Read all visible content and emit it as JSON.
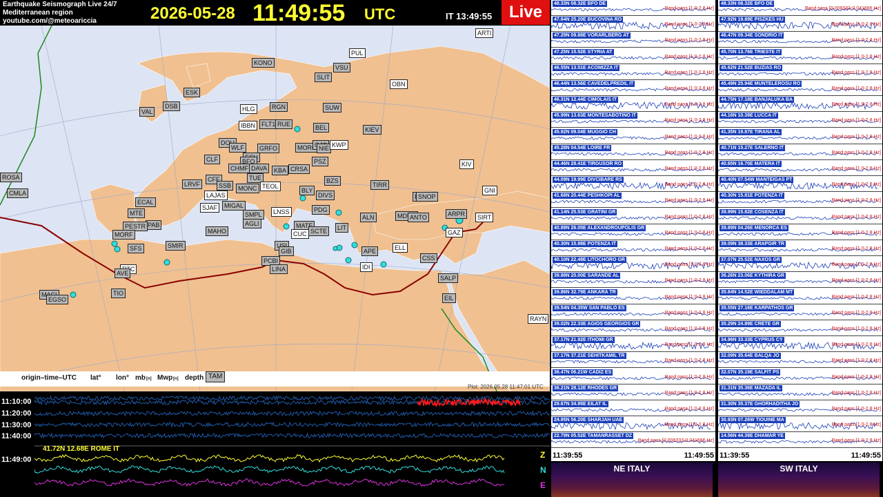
{
  "header": {
    "line1": "Earthquake Seismograph Live 24/7",
    "line2": "Mediterranean region",
    "line3": "youtube.com/@meteoariccia",
    "date": "2026-05-28",
    "time": "11:49:55",
    "tz": "UTC",
    "local": "IT 13:49:55",
    "live": "Live"
  },
  "legend": {
    "origin": "origin–time–UTC",
    "lat": "lat°",
    "lon": "lon°",
    "mb": "mb",
    "mb_sub": "[n]",
    "mwp": "Mwp",
    "mwp_sub": "[n]",
    "depth": "depth",
    "station": "TAM"
  },
  "plot_note": "Plot: 2026.05.28 11:47:01 UTC",
  "map_stations": [
    {
      "t": "ARTI",
      "w": 1
    },
    {
      "t": "PUL",
      "w": 1
    },
    {
      "t": "KONO",
      "w": 0
    },
    {
      "t": "VSU",
      "w": 0
    },
    {
      "t": "SLIT",
      "w": 0
    },
    {
      "t": "OBN",
      "w": 1
    },
    {
      "t": "ESK",
      "w": 0
    },
    {
      "t": "DSB",
      "w": 0
    },
    {
      "t": "VAL",
      "w": 0
    },
    {
      "t": "HLG",
      "w": 1
    },
    {
      "t": "RGN",
      "w": 0
    },
    {
      "t": "SUW",
      "w": 0
    },
    {
      "t": "IBBN",
      "w": 1
    },
    {
      "t": "FLT1",
      "w": 0
    },
    {
      "t": "RUE",
      "w": 0
    },
    {
      "t": "BEL",
      "w": 0
    },
    {
      "t": "KIEV",
      "w": 0
    },
    {
      "t": "DOU",
      "w": 0
    },
    {
      "t": "WLF",
      "w": 0
    },
    {
      "t": "GRFO",
      "w": 0
    },
    {
      "t": "MORC",
      "w": 0
    },
    {
      "t": "OJC",
      "w": 0
    },
    {
      "t": "NIE",
      "w": 0
    },
    {
      "t": "KWP",
      "w": 1
    },
    {
      "t": "CLF",
      "w": 0
    },
    {
      "t": "ECH",
      "w": 0
    },
    {
      "t": "BFO",
      "w": 0
    },
    {
      "t": "CHMF",
      "w": 0
    },
    {
      "t": "DAVA",
      "w": 0
    },
    {
      "t": "KBA",
      "w": 0
    },
    {
      "t": "CRSA",
      "w": 0
    },
    {
      "t": "PSZ",
      "w": 0
    },
    {
      "t": "KIV",
      "w": 1
    },
    {
      "t": "CFF",
      "w": 0
    },
    {
      "t": "SSB",
      "w": 0
    },
    {
      "t": "TUE",
      "w": 0
    },
    {
      "t": "LRVF",
      "w": 0
    },
    {
      "t": "MONC",
      "w": 0
    },
    {
      "t": "TEOL",
      "w": 1
    },
    {
      "t": "BZS",
      "w": 0
    },
    {
      "t": "TIRR",
      "w": 0
    },
    {
      "t": "GNI",
      "w": 1
    },
    {
      "t": "ROSA",
      "w": 0
    },
    {
      "t": "CMLA",
      "w": 0
    },
    {
      "t": "LAJAS",
      "w": 1
    },
    {
      "t": "BLY",
      "w": 0
    },
    {
      "t": "DIVS",
      "w": 0
    },
    {
      "t": "SJAF",
      "w": 1
    },
    {
      "t": "MIGAL",
      "w": 0
    },
    {
      "t": "ECAL",
      "w": 0
    },
    {
      "t": "BZN",
      "w": 0
    },
    {
      "t": "SNOP",
      "w": 0
    },
    {
      "t": "PDG",
      "w": 0
    },
    {
      "t": "SMPL",
      "w": 0
    },
    {
      "t": "LNSS",
      "w": 1
    },
    {
      "t": "MAHO",
      "w": 0
    },
    {
      "t": "AGLI",
      "w": 0
    },
    {
      "t": "MATE",
      "w": 0
    },
    {
      "t": "CUC",
      "w": 1
    },
    {
      "t": "SCTE",
      "w": 0
    },
    {
      "t": "LIT",
      "w": 0
    },
    {
      "t": "ALN",
      "w": 0
    },
    {
      "t": "MDUB",
      "w": 0
    },
    {
      "t": "ANTO",
      "w": 0
    },
    {
      "t": "ARPR",
      "w": 0
    },
    {
      "t": "SIRT",
      "w": 1
    },
    {
      "t": "GAZ",
      "w": 1
    },
    {
      "t": "PAB",
      "w": 0
    },
    {
      "t": "PESTR",
      "w": 0
    },
    {
      "t": "MTE",
      "w": 0
    },
    {
      "t": "SFS",
      "w": 0
    },
    {
      "t": "MORF",
      "w": 0
    },
    {
      "t": "SMIR",
      "w": 0
    },
    {
      "t": "USI",
      "w": 0
    },
    {
      "t": "GIB",
      "w": 0
    },
    {
      "t": "APE",
      "w": 0
    },
    {
      "t": "ELL",
      "w": 1
    },
    {
      "t": "IDI",
      "w": 1
    },
    {
      "t": "CSS",
      "w": 0
    },
    {
      "t": "RTC",
      "w": 1
    },
    {
      "t": "AVE",
      "w": 0
    },
    {
      "t": "PCBI",
      "w": 0
    },
    {
      "t": "LINA",
      "w": 0
    },
    {
      "t": "SALP",
      "w": 0
    },
    {
      "t": "MACI",
      "w": 0
    },
    {
      "t": "EGSO",
      "w": 0
    },
    {
      "t": "TIO",
      "w": 0
    },
    {
      "t": "EIL",
      "w": 0
    },
    {
      "t": "RAYN",
      "w": 1
    }
  ],
  "helicorder": {
    "times": [
      "11:10:00",
      "11:20:00",
      "11:30:00",
      "11:40:00",
      "11:49:00"
    ],
    "rome_label": "41.72N 12.68E ROME IT",
    "components": [
      "Z",
      "N",
      "E"
    ],
    "component_colors": [
      "#ffff33",
      "#33dddd",
      "#dd33dd"
    ]
  },
  "col1": {
    "rows": [
      {
        "n": "48.33N 08.32E BFO DE",
        "b": "Band pass [1.0-2.8 Hz]"
      },
      {
        "n": "47.64N 25.20E BUCOVINA RO",
        "b": "Band pass [1.0-2.8 Hz]"
      },
      {
        "n": "47.29N 09.88E VORARLBERG AT",
        "b": "Band pass [1.0-2.8 Hz]"
      },
      {
        "n": "47.25N 15.52E STYRIA AT",
        "b": "Band pass [1.0-2.8 Hz]"
      },
      {
        "n": "46.55N 13.51E ACOMIZZA IT",
        "b": "Band pass [1.0-2.8 Hz]"
      },
      {
        "n": "46.44N 13.56E CAVEDELPREDIL IT",
        "b": "Band pass [1.0-2.8 Hz]"
      },
      {
        "n": "46.31N 12.44E CIMOLAIS IT",
        "b": "Band pass [1.0-2.8 Hz]"
      },
      {
        "n": "45.99N 13.63E MONTESABOTINO IT",
        "b": "Band pass [1.0-2.8 Hz]"
      },
      {
        "n": "45.92N 09.04E MUGGIO CH",
        "b": "Band pass [1.0-2.8 Hz]"
      },
      {
        "n": "45.28N 04.54E LOIRE FR",
        "b": "Band pass [1.0-2.8 Hz]"
      },
      {
        "n": "44.46N 28.41E TIRGUSOR RO",
        "b": "Band pass [1.0-2.8 Hz]"
      },
      {
        "n": "44.09N 19.99E DIVCIBARE RS",
        "b": "Band pass [1.0-2.8 Hz]"
      },
      {
        "n": "41.68N 20.44E PESHKOPI AL",
        "b": "Band pass [1.0-2.8 Hz]"
      },
      {
        "n": "41.14N 25.53E GRATINI GR",
        "b": "Band pass [1.0-2.8 Hz]"
      },
      {
        "n": "40.89N 26.05E ALEXANDROUPOLIS GR",
        "b": "Band pass [1.0-2.8 Hz]"
      },
      {
        "n": "40.30N 15.98E POTENZA IT",
        "b": "Band pass [1.0-2.8 Hz]"
      },
      {
        "n": "40.10N 22.48E LITOCHORO GR",
        "b": "Band pass [1.0-2.8 Hz]"
      },
      {
        "n": "39.88N 20.00E SARANDE AL",
        "b": "Band pass [1.0-2.8 Hz]"
      },
      {
        "n": "39.86N 32.79E ANKARA TR",
        "b": "Band pass [1.0-2.8 Hz]"
      },
      {
        "n": "39.54N 04.35W SAN PABLO ES",
        "b": "Band pass [1.0-2.8 Hz]"
      },
      {
        "n": "39.02N 22.33E AGIOS GEORGIOS GR",
        "b": "Band pass [1.0-2.8 Hz]"
      },
      {
        "n": "37.17N 21.92E ITHOMI GR",
        "b": "Band pass [1.0-2.8 Hz]"
      },
      {
        "n": "37.17N 37.21E SEHITKAMIL TR",
        "b": "Band pass [1.0-2.8 Hz]"
      },
      {
        "n": "36.47N 06.21W CADIZ ES",
        "b": "Band pass [1.0-2.8 Hz]"
      },
      {
        "n": "36.21N 28.12E RHODES GR",
        "b": "Band pass [1.0-2.8 Hz]"
      },
      {
        "n": "29.67N 34.95E EILAT IL",
        "b": "Band pass [1.0-2.8 Hz]"
      },
      {
        "n": "24.95N 56.20E SHARJAH UAE",
        "b": "Band pass [1.0-2.8 Hz]"
      },
      {
        "n": "22.79N 05.52E TAMANRASSET DZ",
        "b": "Band pass [0.008333-0.041666 Hz]"
      }
    ],
    "t_start": "11:39:55",
    "t_end": "11:49:55",
    "spec": "NE ITALY"
  },
  "col2": {
    "rows": [
      {
        "n": "48.33N 08.32E BFO DE",
        "b": "Band pass [0.008333-0.041666 Hz]"
      },
      {
        "n": "47.92N 19.89E PISZKES HU",
        "b": "Band pass [1.0-2.8 Hz]"
      },
      {
        "n": "46.47N 09.34E SONDRIO IT",
        "b": "Band pass [1.0-2.8 Hz]"
      },
      {
        "n": "45.70N 13.76E TRIESTE IT",
        "b": "Band pass [1.0-2.8 Hz]"
      },
      {
        "n": "45.62N 21.52E BUZIAS RO",
        "b": "Band pass [1.0-2.8 Hz]"
      },
      {
        "n": "45.49N 25.94E MUNTELEROSU RO",
        "b": "Band pass [1.0-2.8 Hz]"
      },
      {
        "n": "44.75N 17.18E BANJALUKA BA",
        "b": "Band pass [1.0-2.8 Hz]"
      },
      {
        "n": "44.16N 10.39E LUCCA IT",
        "b": "Band pass [1.0-2.8 Hz]"
      },
      {
        "n": "41.35N 19.87E TIRANA AL",
        "b": "Band pass [1.0-2.8 Hz]"
      },
      {
        "n": "40.71N 15.27E SALERNO IT",
        "b": "Band pass [1.0-2.8 Hz]"
      },
      {
        "n": "40.65N 16.70E MATERA IT",
        "b": "Band pass [1.0-2.8 Hz]"
      },
      {
        "n": "40.40N 07.54W MANTEIGAS PT",
        "b": "Band pass [1.0-2.8 Hz]"
      },
      {
        "n": "40.30N 15.81E POTENZA IT",
        "b": "Band pass [1.0-2.8 Hz]"
      },
      {
        "n": "39.99N 15.82E COSENZA IT",
        "b": "Band pass [1.0-2.8 Hz]"
      },
      {
        "n": "39.89N 04.26E MENORCA ES",
        "b": "Band pass [1.0-2.8 Hz]"
      },
      {
        "n": "39.09N 38.33E ARAPGIR TR",
        "b": "Band pass [1.0-2.8 Hz]"
      },
      {
        "n": "37.07N 25.52E NAXOS GR",
        "b": "Band pass [1.0-2.8 Hz]"
      },
      {
        "n": "36.26N 23.06E KYTHIRA GR",
        "b": "Band pass [1.0-2.8 Hz]"
      },
      {
        "n": "35.84N 14.52E WIEDDALAM MT",
        "b": "Band pass [1.0-2.8 Hz]"
      },
      {
        "n": "35.55N 27.16E KARPATHOS GR",
        "b": "Band pass [1.0-2.8 Hz]"
      },
      {
        "n": "35.29N 24.89E CRETE GR",
        "b": "Band pass [1.0-2.8 Hz]"
      },
      {
        "n": "34.96N 33.33E CYPRUS CY",
        "b": "Band pass [1.0-2.8 Hz]"
      },
      {
        "n": "32.09N 35.64E BALQA JO",
        "b": "Band pass [1.0-2.8 Hz]"
      },
      {
        "n": "32.07N 35.19E SALFIT PS",
        "b": "Band pass [1.0-2.8 Hz]"
      },
      {
        "n": "31.31N 35.36E MAZADA IL",
        "b": "Band pass [1.0-2.8 Hz]"
      },
      {
        "n": "31.30N 35.37E GHORHADITHA JO",
        "b": "Band pass [1.0-2.8 Hz]"
      },
      {
        "n": "30.93N 07.26W TIOUINE MA",
        "b": "Band pass [1.0-2.8 Hz]"
      },
      {
        "n": "14.56N 44.39E DHAMAR YE",
        "b": "Band pass [1.0-2.8 Hz]"
      }
    ],
    "t_start": "11:39:55",
    "t_end": "11:49:55",
    "spec": "SW ITALY"
  },
  "colors": {
    "land": "#f0c090",
    "sea": "#dde4f4",
    "plate": "#8b0000",
    "trace": "#1a3fb8",
    "live": "#e01010",
    "heli_trace": "#1f5aa8",
    "heli_event": "#ff1a1a"
  }
}
